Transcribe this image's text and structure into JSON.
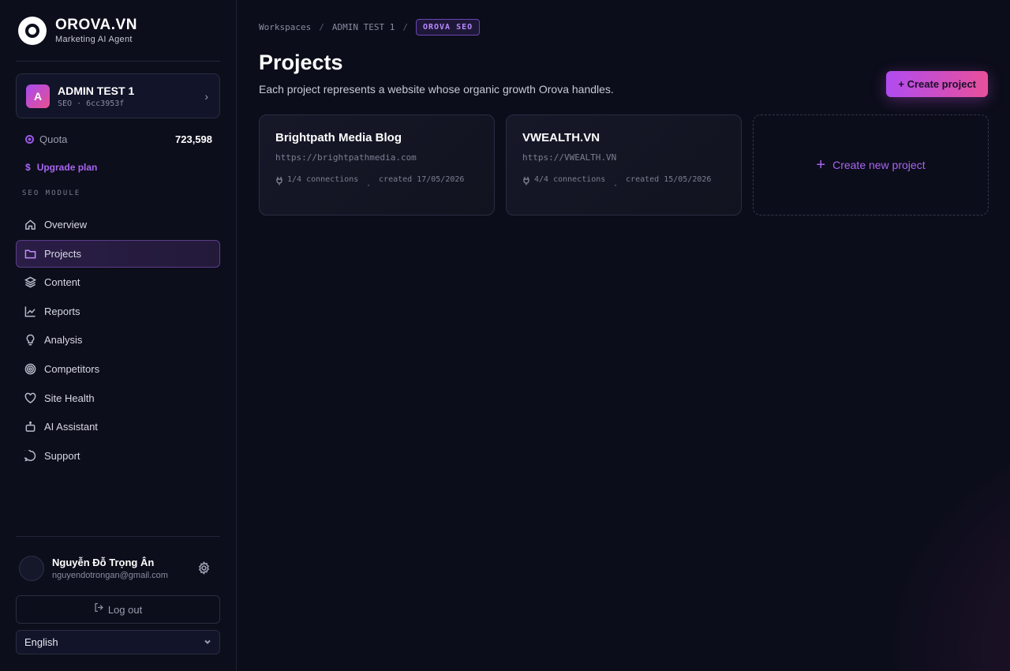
{
  "brand": {
    "name": "OROVA.VN",
    "subtitle": "Marketing AI Agent"
  },
  "workspace": {
    "initial": "A",
    "name": "ADMIN TEST 1",
    "meta": "SEO · 6cc3953f"
  },
  "quota": {
    "label": "Quota",
    "value": "723,598"
  },
  "upgrade": {
    "icon": "$",
    "label": "Upgrade plan"
  },
  "sidebar": {
    "section_label": "SEO MODULE",
    "items": [
      {
        "label": "Overview",
        "icon": "home-icon",
        "active": false
      },
      {
        "label": "Projects",
        "icon": "folder-icon",
        "active": true
      },
      {
        "label": "Content",
        "icon": "layers-icon",
        "active": false
      },
      {
        "label": "Reports",
        "icon": "chart-icon",
        "active": false
      },
      {
        "label": "Analysis",
        "icon": "lightbulb-icon",
        "active": false
      },
      {
        "label": "Competitors",
        "icon": "target-icon",
        "active": false
      },
      {
        "label": "Site Health",
        "icon": "heart-icon",
        "active": false
      },
      {
        "label": "AI Assistant",
        "icon": "robot-icon",
        "active": false
      },
      {
        "label": "Support",
        "icon": "chat-icon",
        "active": false
      }
    ]
  },
  "user": {
    "name": "Nguyễn Đỗ Trọng Ân",
    "email": "nguyendotrongan@gmail.com"
  },
  "logout": {
    "label": "Log out"
  },
  "language": {
    "selected": "English"
  },
  "breadcrumb": {
    "items": [
      "Workspaces",
      "ADMIN TEST 1"
    ],
    "separator": "/",
    "current": "OROVA SEO"
  },
  "page": {
    "title": "Projects",
    "subtitle": "Each project represents a website whose organic growth Orova handles.",
    "create_button": "+ Create project"
  },
  "projects": [
    {
      "name": "Brightpath Media Blog",
      "url": "https://brightpathmedia.com",
      "connections": "1/4 connections",
      "created": "created 17/05/2026"
    },
    {
      "name": "VWEALTH.VN",
      "url": "https://VWEALTH.VN",
      "connections": "4/4 connections",
      "created": "created 15/05/2026"
    }
  ],
  "new_project": {
    "label": "Create new project"
  },
  "colors": {
    "accent": "#a865f0",
    "gradient_start": "#b04cf0",
    "gradient_end": "#e8509a",
    "background": "#0b0d1a"
  }
}
